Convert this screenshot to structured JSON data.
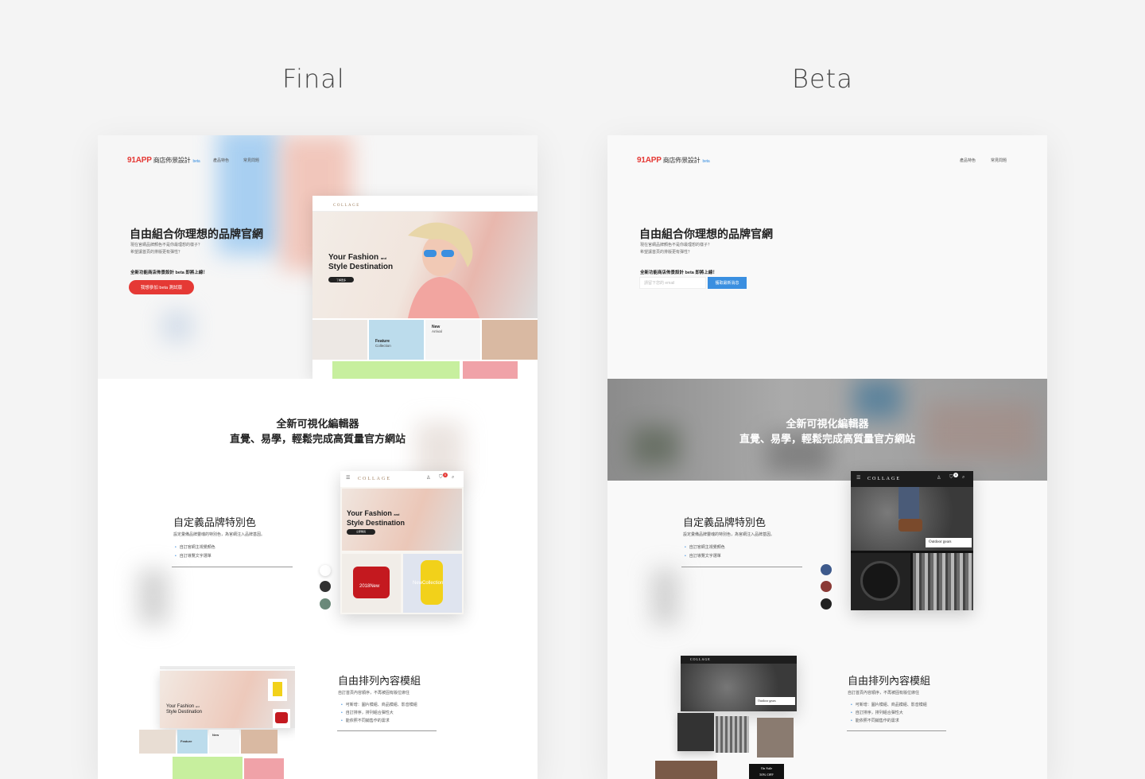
{
  "columns": {
    "final_title": "Final",
    "beta_title": "Beta"
  },
  "header": {
    "logo_brand": "91APP",
    "logo_text": "商店佈景設計",
    "logo_beta": "beta",
    "nav": [
      "產品特色",
      "常見問題"
    ]
  },
  "hero": {
    "title": "自由組合你理想的品牌官網",
    "sub1": "現在官網品牌顏色不是你最理想的樣子？",
    "sub2": "希望讓首頁的排版更有彈性？",
    "note": "全新功能商店佈景設計 beta 即將上線！",
    "cta": "我想參加 beta 測試版",
    "email_placeholder": "請留下您的 email",
    "subscribe": "獲取最新消息"
  },
  "mock": {
    "brand": "COLLAGE",
    "hero_line1": "Your Fashion",
    "hero_and": "and",
    "hero_line2": "Style Destination",
    "button": "了解更多",
    "feature": "Feature",
    "collection": "Collection",
    "new": "New",
    "arrival": "Arrival",
    "phone_button": "立即購買",
    "bag_label": "2018New",
    "collection_label": "NewCollection",
    "outdoor": "Outdoor gears",
    "sale1": "On Sale",
    "sale2": "50% OFF",
    "cart_count": "0"
  },
  "section2": {
    "line1": "全新可視化編輯器",
    "line2": "直覺、易學，輕鬆完成高質量官方網站"
  },
  "feature1": {
    "title": "自定義品牌特別色",
    "desc": "設定彙備品牌靈魂的特別色，為官網注入品牌基因。",
    "items": [
      "自訂官網主視覺顏色",
      "自訂導覽文字選單"
    ],
    "final_swatches": [
      "#ffffff",
      "#333333",
      "#6b8a7a"
    ],
    "beta_swatches": [
      "#3e5a8c",
      "#8b3a36",
      "#222222"
    ]
  },
  "feature2": {
    "title": "自由排列內容模組",
    "desc": "自訂首頁內容順序，不再被固有版位綁住",
    "items": [
      "可新增：圖片模組、商品模組、影音模組",
      "自訂排序，排列組合彈性大",
      "能依照不同銷售作的需求"
    ]
  }
}
